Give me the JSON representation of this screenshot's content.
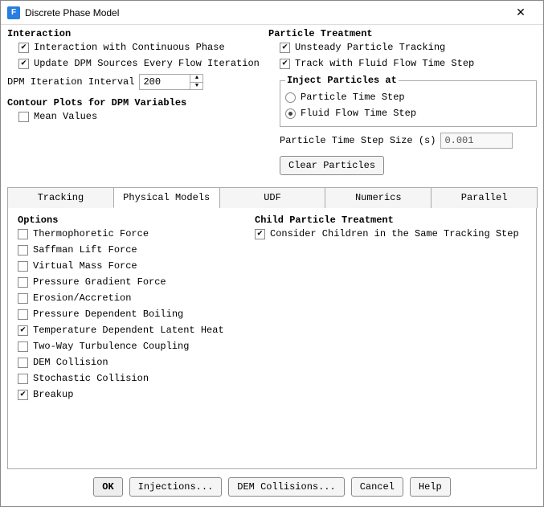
{
  "title": "Discrete Phase Model",
  "app_icon_letter": "F",
  "interaction": {
    "heading": "Interaction",
    "opt1": "Interaction with Continuous Phase",
    "opt2": "Update DPM Sources Every Flow Iteration",
    "interval_label": "DPM Iteration Interval",
    "interval_value": "200"
  },
  "contour": {
    "heading": "Contour Plots for DPM Variables",
    "mean": "Mean Values"
  },
  "particle": {
    "heading": "Particle Treatment",
    "unsteady": "Unsteady Particle Tracking",
    "track_flow": "Track with Fluid Flow Time Step",
    "inject_heading": "Inject Particles at",
    "inject_pts": "Particle Time Step",
    "inject_ffs": "Fluid Flow Time Step",
    "step_label": "Particle Time Step Size (s)",
    "step_value": "0.001",
    "clear_btn": "Clear Particles"
  },
  "tabs": {
    "t0": "Tracking",
    "t1": "Physical Models",
    "t2": "UDF",
    "t3": "Numerics",
    "t4": "Parallel"
  },
  "options": {
    "heading": "Options",
    "items": [
      {
        "label": "Thermophoretic Force",
        "checked": false
      },
      {
        "label": "Saffman Lift Force",
        "checked": false
      },
      {
        "label": "Virtual Mass Force",
        "checked": false
      },
      {
        "label": "Pressure Gradient Force",
        "checked": false
      },
      {
        "label": "Erosion/Accretion",
        "checked": false
      },
      {
        "label": "Pressure Dependent Boiling",
        "checked": false
      },
      {
        "label": "Temperature Dependent Latent Heat",
        "checked": true
      },
      {
        "label": "Two-Way Turbulence Coupling",
        "checked": false
      },
      {
        "label": "DEM Collision",
        "checked": false
      },
      {
        "label": "Stochastic Collision",
        "checked": false
      },
      {
        "label": "Breakup",
        "checked": true
      }
    ]
  },
  "child": {
    "heading": "Child Particle Treatment",
    "consider": "Consider Children in the Same Tracking Step"
  },
  "footer": {
    "ok": "OK",
    "injections": "Injections...",
    "dem": "DEM Collisions...",
    "cancel": "Cancel",
    "help": "Help"
  }
}
